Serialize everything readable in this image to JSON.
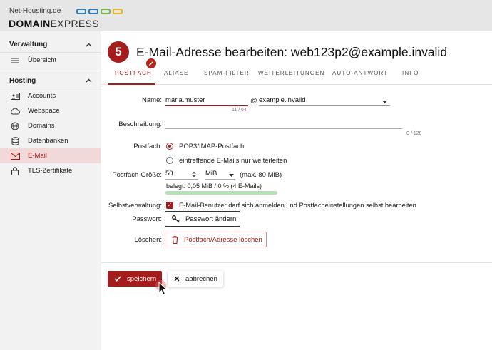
{
  "header": {
    "site_name": "Net-Housting.de",
    "brand_bold": "DOMAIN",
    "brand_light": "EXPRESS"
  },
  "sidebar": {
    "sections": [
      {
        "label": "Verwaltung",
        "items": [
          {
            "label": "Übersicht",
            "icon": "list-icon"
          }
        ]
      },
      {
        "label": "Hosting",
        "items": [
          {
            "label": "Accounts",
            "icon": "contact-card-icon"
          },
          {
            "label": "Webspace",
            "icon": "cloud-icon"
          },
          {
            "label": "Domains",
            "icon": "globe-icon"
          },
          {
            "label": "Datenbanken",
            "icon": "database-icon"
          },
          {
            "label": "E-Mail",
            "icon": "envelope-icon",
            "active": true
          },
          {
            "label": "TLS-Zertifikate",
            "icon": "lock-icon"
          }
        ]
      }
    ]
  },
  "page": {
    "step_number": "5",
    "title": "E-Mail-Adresse bearbeiten: web123p2@example.invalid"
  },
  "tabs": [
    {
      "label": "POSTFACH",
      "active": true
    },
    {
      "label": "ALIASE"
    },
    {
      "label": "SPAM-FILTER"
    },
    {
      "label": "WEITERLEITUNGEN"
    },
    {
      "label": "AUTO-ANTWORT"
    },
    {
      "label": "INFO"
    }
  ],
  "form": {
    "name_label": "Name:",
    "name_value": "maria.muster",
    "name_counter": "11 / 64",
    "at_sign": "@",
    "domain_value": "example.invalid",
    "description_label": "Beschreibung:",
    "description_value": "",
    "description_counter": "0 / 128",
    "mailbox_label": "Postfach:",
    "mailbox_option_1": "POP3/IMAP-Postfach",
    "mailbox_option_2": "eintreffende E-Mails nur weiterleiten",
    "size_label": "Postfach-Größe:",
    "size_value": "50",
    "size_unit": "MiB",
    "size_max": "(max. 80 MiB)",
    "usage_text": "belegt: 0,05 MiB / 0 % (4 E-Mails)",
    "usage_fraction": 0.01,
    "self_admin_label": "Selbstverwaltung:",
    "self_admin_text": "E-Mail-Benutzer darf sich anmelden und Postfacheinstellungen selbst bearbeiten",
    "password_label": "Passwort:",
    "password_button": "Passwort ändern",
    "delete_label": "Löschen:",
    "delete_button": "Postfach/Adresse löschen"
  },
  "actions": {
    "save": "speichern",
    "cancel": "abbrechen"
  },
  "colors": {
    "accent": "#a51c1c",
    "active_bg": "#f1d9d9",
    "usage_bar": "#b6e0b6"
  }
}
